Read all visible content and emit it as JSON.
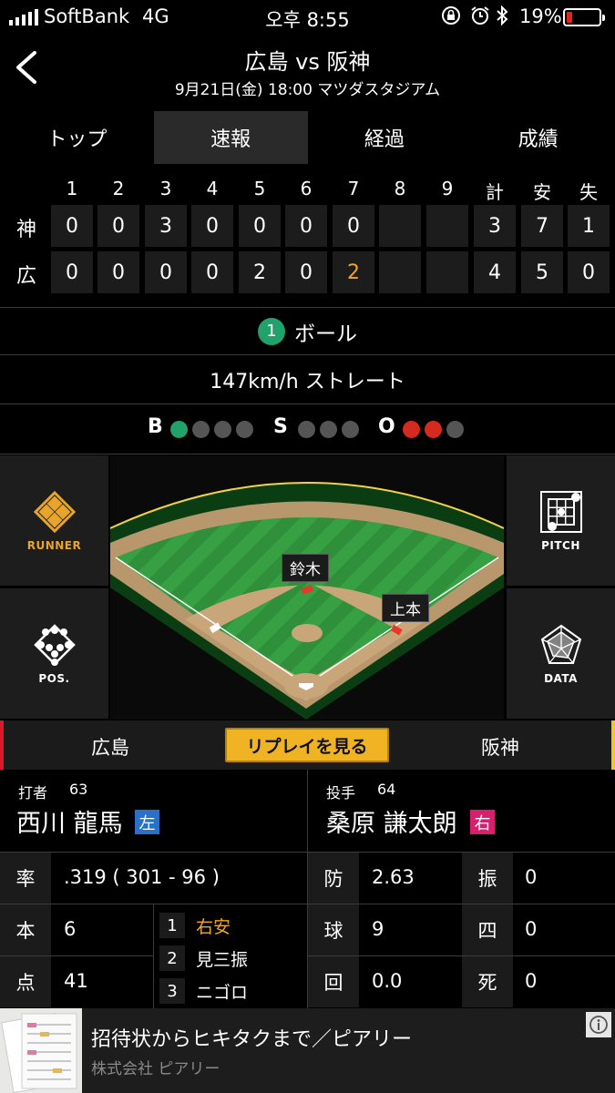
{
  "status": {
    "carrier": "SoftBank",
    "network": "4G",
    "time": "오후 8:55",
    "battery_pct": "19%",
    "battery_level": 0.19,
    "battery_color": "#e0251b"
  },
  "header": {
    "title": "広島 vs 阪神",
    "subtitle": "9月21日(金) 18:00 マツダスタジアム",
    "back_icon": "chevron-left-icon"
  },
  "tabs": [
    {
      "label": "トップ",
      "active": false
    },
    {
      "label": "速報",
      "active": true
    },
    {
      "label": "経過",
      "active": false
    },
    {
      "label": "成績",
      "active": false
    }
  ],
  "scoreboard": {
    "headers": [
      "1",
      "2",
      "3",
      "4",
      "5",
      "6",
      "7",
      "8",
      "9",
      "計",
      "安",
      "失"
    ],
    "rows": [
      {
        "team": "神",
        "cells": [
          "0",
          "0",
          "3",
          "0",
          "0",
          "0",
          "0",
          "",
          "",
          "3",
          "7",
          "1"
        ]
      },
      {
        "team": "広",
        "cells": [
          "0",
          "0",
          "0",
          "0",
          "2",
          "0",
          "2",
          "",
          "",
          "4",
          "5",
          "0"
        ]
      }
    ],
    "highlight_color": "#f0a823"
  },
  "pitch": {
    "number": "1",
    "result": "ボール",
    "speed_type": "147km/h ストレート"
  },
  "count": {
    "balls_label": "B",
    "balls": 1,
    "strikes_label": "S",
    "strikes": 0,
    "outs_label": "O",
    "outs": 2
  },
  "side_buttons": {
    "runner": "RUNNER",
    "pos": "POS.",
    "pitch": "PITCH",
    "data": "DATA"
  },
  "field": {
    "runner_second": "鈴木",
    "runner_first": "上本"
  },
  "teambar": {
    "home": "広島",
    "replay": "リプレイを見る",
    "away": "阪神"
  },
  "batter": {
    "role": "打者",
    "number": "63",
    "name": "西川 龍馬",
    "hand": "左",
    "hand_color": "#2a70c6",
    "avg_label": "率",
    "avg_value": ".319 ( 301 - 96 )",
    "hr_label": "本",
    "hr_value": "6",
    "rbi_label": "点",
    "rbi_value": "41",
    "results": [
      {
        "no": "1",
        "text": "右安",
        "hit": true
      },
      {
        "no": "2",
        "text": "見三振",
        "hit": false
      },
      {
        "no": "3",
        "text": "ニゴロ",
        "hit": false
      }
    ]
  },
  "pitcher": {
    "role": "投手",
    "number": "64",
    "name": "桑原 謙太朗",
    "hand": "右",
    "hand_color": "#d81f6e",
    "era_label": "防",
    "era_value": "2.63",
    "so_label": "振",
    "so_value": "0",
    "pitches_label": "球",
    "pitches_value": "9",
    "bb_label": "四",
    "bb_value": "0",
    "ip_label": "回",
    "ip_value": "0.0",
    "hbp_label": "死",
    "hbp_value": "0"
  },
  "ad": {
    "title": "招待状からヒキタクまで／ピアリー",
    "sponsor": "株式会社 ピアリー"
  }
}
